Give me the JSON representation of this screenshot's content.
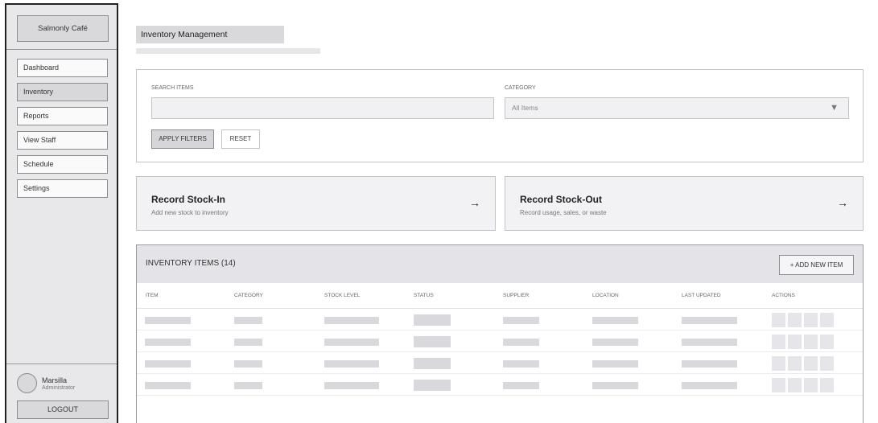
{
  "sidebar": {
    "brand": "Salmonly Café",
    "items": [
      {
        "label": "Dashboard",
        "active": false
      },
      {
        "label": "Inventory",
        "active": true
      },
      {
        "label": "Reports",
        "active": false
      },
      {
        "label": "View Staff",
        "active": false
      },
      {
        "label": "Schedule",
        "active": false
      },
      {
        "label": "Settings",
        "active": false
      }
    ],
    "user": {
      "name": "Marsilla",
      "role": "Administrator"
    },
    "logout_label": "LOGOUT"
  },
  "main": {
    "page_title": "Inventory Management",
    "filters": {
      "search_label": "SEARCH ITEMS",
      "search_value": "",
      "category_label": "CATEGORY",
      "category_value": "All Items",
      "apply_label": "APPLY FILTERS",
      "reset_label": "RESET"
    },
    "actions": [
      {
        "title": "Record Stock-In",
        "subtitle": "Add new stock to inventory",
        "arrow": "→"
      },
      {
        "title": "Record Stock-Out",
        "subtitle": "Record usage, sales, or waste",
        "arrow": "→"
      }
    ],
    "inventory": {
      "title": "INVENTORY ITEMS (14)",
      "add_label": "+ ADD NEW ITEM",
      "columns": [
        "ITEM",
        "CATEGORY",
        "STOCK LEVEL",
        "STATUS",
        "SUPPLIER",
        "LOCATION",
        "LAST UPDATED",
        "ACTIONS"
      ],
      "visible_rows": 4
    }
  },
  "colors": {
    "sidebar_bg": "#e8e8ea",
    "active_nav": "#d8d8db",
    "header_bg": "#e4e4e8",
    "placeholder": "#d9d9dd",
    "border": "#c4c4c8"
  }
}
